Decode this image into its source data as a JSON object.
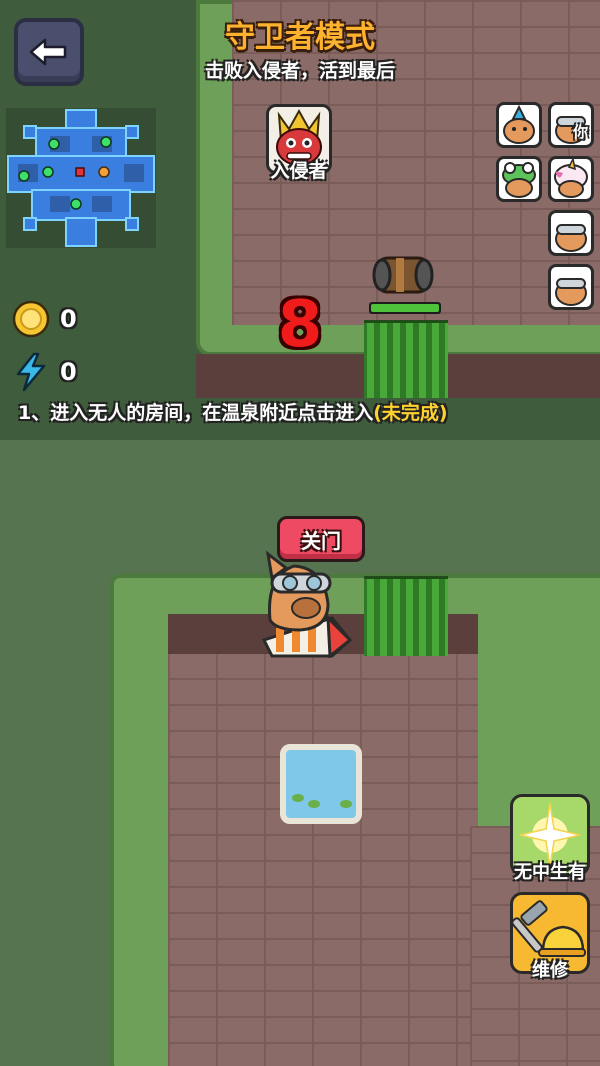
{
  "header": {
    "title": "守卫者模式",
    "subtitle": "击败入侵者，活到最后"
  },
  "back_button": {
    "icon": "back-arrow-icon"
  },
  "invader": {
    "label": "入侵者",
    "icon": "red-dragon-invader-icon"
  },
  "players": [
    {
      "icon": "capybara-blue-crest-icon",
      "you_label": ""
    },
    {
      "icon": "capybara-goggles-icon",
      "you_label": "你"
    },
    {
      "icon": "capybara-frog-hat-icon",
      "you_label": ""
    },
    {
      "icon": "capybara-unicorn-hat-icon",
      "you_label": ""
    },
    {
      "icon": "capybara-goggles-icon",
      "you_label": ""
    },
    {
      "icon": "capybara-goggles-icon",
      "you_label": ""
    }
  ],
  "resources": {
    "coins": "0",
    "energy": "0"
  },
  "task": {
    "text": "1、进入无人的房间，在温泉附近点击进入",
    "status": "(未完成)"
  },
  "countdown": "8",
  "door_button": {
    "label": "关门"
  },
  "skills": [
    {
      "label": "无中生有",
      "icon": "sparkle-light-icon"
    },
    {
      "label": "维修",
      "icon": "hammer-helmet-icon"
    }
  ],
  "colors": {
    "title": "#ffb22e",
    "task_status": "#ffd22e",
    "countdown": "#f01c1c",
    "door_button": "#ee4a63",
    "grass": "#56744f",
    "floor": "#8a6b67"
  }
}
